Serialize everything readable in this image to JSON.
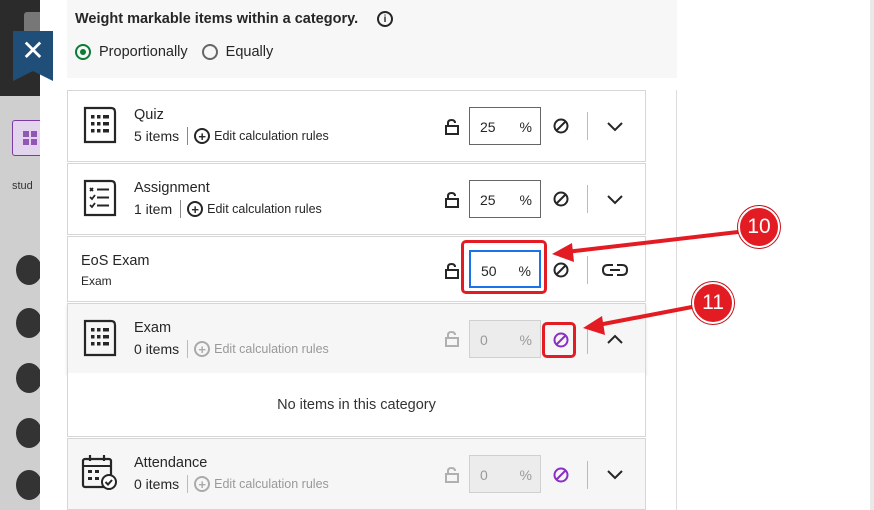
{
  "weighting": {
    "title": "Weight markable items within a category.",
    "info_icon": "info-icon",
    "options": [
      {
        "label": "Proportionally",
        "selected": true
      },
      {
        "label": "Equally",
        "selected": false
      }
    ]
  },
  "background": {
    "student_label": "stud"
  },
  "close_label": "✕",
  "edit_rules_label": "Edit calculation rules",
  "percent_sign": "%",
  "categories": [
    {
      "name": "Quiz",
      "count": "5 items",
      "value": "25",
      "icon": "quiz-icon",
      "expand": "chevron-down-icon"
    },
    {
      "name": "Assignment",
      "count": "1 item",
      "value": "25",
      "icon": "assignment-icon",
      "expand": "chevron-down-icon"
    },
    {
      "name": "EoS Exam",
      "subtitle": "Exam",
      "value": "50",
      "icon": "link-icon"
    },
    {
      "name": "Exam",
      "count": "0 items",
      "value": "0",
      "icon": "quiz-icon",
      "expand": "chevron-up-icon"
    },
    {
      "name": "Attendance",
      "count": "0 items",
      "value": "0",
      "icon": "attendance-icon",
      "expand": "chevron-down-icon"
    }
  ],
  "empty_message": "No items in this category",
  "callouts": [
    {
      "number": "10"
    },
    {
      "number": "11"
    }
  ],
  "colors": {
    "accent_green": "#0a7c33",
    "purple": "#8a2fc4",
    "callout_red": "#e31c23",
    "focus_blue": "#1a73e8"
  }
}
